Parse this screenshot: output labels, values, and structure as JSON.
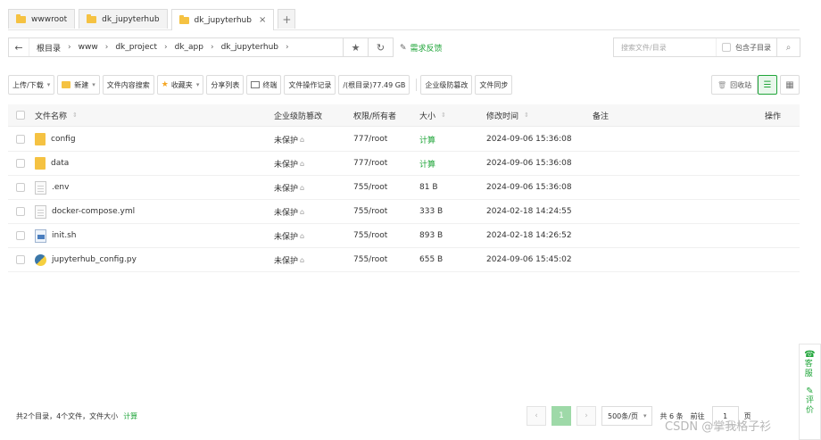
{
  "tabs": [
    {
      "label": "wwwroot",
      "active": false
    },
    {
      "label": "dk_jupyterhub",
      "active": false
    },
    {
      "label": "dk_jupyterhub",
      "active": true,
      "closable": true
    }
  ],
  "address": {
    "crumbs": [
      "根目录",
      "www",
      "dk_project",
      "dk_app",
      "dk_jupyterhub"
    ],
    "feedback": "需求反馈"
  },
  "search": {
    "placeholder": "搜索文件/目录",
    "subdir_label": "包含子目录"
  },
  "toolbar": {
    "upload": "上传/下载",
    "new": "新建",
    "content_search": "文件内容搜索",
    "favorites": "收藏夹",
    "share_list": "分享列表",
    "terminal": "终端",
    "op_log": "文件操作记录",
    "disk": "/(根目录)77.49 GB",
    "protect": "企业级防篡改",
    "sync": "文件同步",
    "recycle": "回收站"
  },
  "table": {
    "headers": {
      "name": "文件名称",
      "protect": "企业级防篡改",
      "perm": "权限/所有者",
      "size": "大小",
      "time": "修改时间",
      "note": "备注",
      "op": "操作"
    },
    "rows": [
      {
        "name": "config",
        "type": "folder",
        "protect": "未保护",
        "perm": "777/root",
        "size": "计算",
        "size_link": true,
        "time": "2024-09-06 15:36:08"
      },
      {
        "name": "data",
        "type": "folder",
        "protect": "未保护",
        "perm": "777/root",
        "size": "计算",
        "size_link": true,
        "time": "2024-09-06 15:36:08"
      },
      {
        "name": ".env",
        "type": "file",
        "protect": "未保护",
        "perm": "755/root",
        "size": "81 B",
        "size_link": false,
        "time": "2024-09-06 15:36:08"
      },
      {
        "name": "docker-compose.yml",
        "type": "file",
        "protect": "未保护",
        "perm": "755/root",
        "size": "333 B",
        "size_link": false,
        "time": "2024-02-18 14:24:55"
      },
      {
        "name": "init.sh",
        "type": "sh",
        "protect": "未保护",
        "perm": "755/root",
        "size": "893 B",
        "size_link": false,
        "time": "2024-02-18 14:26:52"
      },
      {
        "name": "jupyterhub_config.py",
        "type": "py",
        "protect": "未保护",
        "perm": "755/root",
        "size": "655 B",
        "size_link": false,
        "time": "2024-09-06 15:45:02"
      }
    ]
  },
  "footer": {
    "summary": "共2个目录，4个文件，文件大小",
    "calc": "计算",
    "page": "1",
    "per_page": "500条/页",
    "total": "共 6 条",
    "goto": "前往",
    "goto_value": "1",
    "page_unit": "页"
  },
  "float": {
    "service": "客服",
    "review": "评价"
  },
  "watermark": "CSDN @掌我格子衫",
  "colors": {
    "accent": "#20a53a",
    "folder": "#f5c242"
  }
}
